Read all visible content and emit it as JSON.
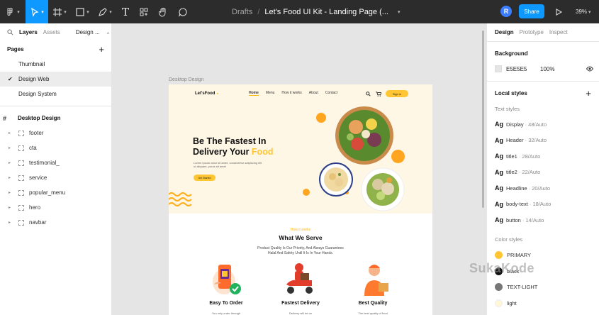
{
  "toolbar": {
    "file_path_prefix": "Drafts",
    "separator": "/",
    "file_name": "Let's Food UI Kit - Landing Page (...",
    "avatar_initial": "R",
    "share_label": "Share",
    "zoom": "39%",
    "accent_color": "#0d99ff"
  },
  "left_panel": {
    "tabs": [
      "Layers",
      "Assets",
      "Design ..."
    ],
    "pages_heading": "Pages",
    "pages": [
      "Thumbnail",
      "Design Web",
      "Design System"
    ],
    "selected_page": "Design Web",
    "root_layer": "Desktop Design",
    "layers": [
      "footer",
      "cta",
      "testimonial_",
      "service",
      "popular_menu",
      "hero",
      "navbar"
    ]
  },
  "canvas": {
    "frame_label": "Desktop Design",
    "logo": "Let'sFood",
    "nav": [
      "Home",
      "Menu",
      "How it works",
      "About",
      "Contact"
    ],
    "signin": "Sign in",
    "hero_title_1": "Be The Fastest In",
    "hero_title_2": "Delivery Your",
    "hero_title_highlight": "Food",
    "hero_sub": "Lorem ipsum dolor sit amet, consectetur adipiscing elit ut aliquam, purus sit amet",
    "hero_button": "Get Started",
    "serve_tag": "How it works",
    "serve_title": "What We Serve",
    "serve_desc_1": "Product Quality Is Our Priority, And Always Guarantees",
    "serve_desc_2": "Halal And Safety Until It Is In Your Hands.",
    "features": [
      {
        "title": "Easy To Order",
        "desc": "You only order through"
      },
      {
        "title": "Fastest Delivery",
        "desc": "Delivery will be on"
      },
      {
        "title": "Best Quality",
        "desc": "The best quality of food"
      }
    ]
  },
  "right_panel": {
    "tabs": [
      "Design",
      "Prototype",
      "Inspect"
    ],
    "background_heading": "Background",
    "background_hex": "E5E5E5",
    "background_opacity": "100%",
    "local_styles_heading": "Local styles",
    "text_styles_heading": "Text styles",
    "text_styles": [
      {
        "name": "Display",
        "meta": "· 48/Auto"
      },
      {
        "name": "Header",
        "meta": "· 32/Auto"
      },
      {
        "name": "title1",
        "meta": "· 28/Auto"
      },
      {
        "name": "title2",
        "meta": "· 22/Auto"
      },
      {
        "name": "Headline",
        "meta": "· 20/Auto"
      },
      {
        "name": "body-text",
        "meta": "· 18/Auto"
      },
      {
        "name": "button",
        "meta": "· 14/Auto"
      }
    ],
    "ag_label": "Ag",
    "color_styles_heading": "Color styles",
    "color_styles": [
      {
        "name": "PRIMARY",
        "color": "#ffc532"
      },
      {
        "name": "black",
        "color": "#111111"
      },
      {
        "name": "TEXT-LIGHT",
        "color": "#777777"
      },
      {
        "name": "light",
        "color": "#fff7d6"
      }
    ]
  },
  "watermark": "SukaKode"
}
